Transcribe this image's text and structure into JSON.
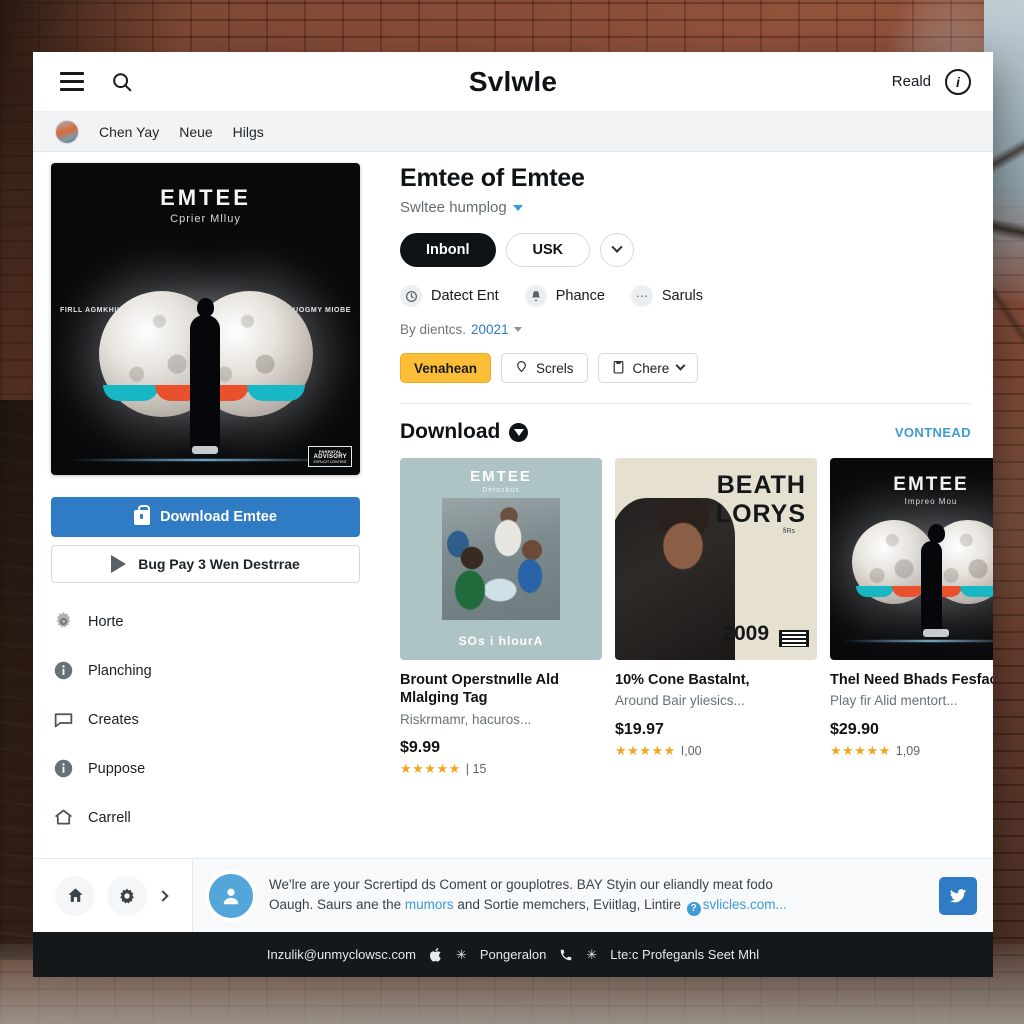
{
  "header": {
    "menu_icon": "hamburger-menu-icon",
    "search_icon": "search-icon",
    "brand": "Svlwle",
    "right_label": "Reald",
    "right_icon": "info-circle-icon"
  },
  "subnav": {
    "avatar": "user-avatar",
    "items": [
      {
        "label": "Chen Yay"
      },
      {
        "label": "Neue"
      },
      {
        "label": "Hilgs"
      }
    ]
  },
  "album": {
    "title": "EMTEE",
    "subtitle": "Cprier Mlluy",
    "side_left": "FIRLL AGMKHIKZHY",
    "side_right": "OLUOGMY MIOBE",
    "advisory_top": "PARENTAL",
    "advisory_mid": "ADVISORY",
    "advisory_bottom": "EXPLICIT CONTENT"
  },
  "sidebar": {
    "download_button": "Download Emtee",
    "download_icon": "lock-icon",
    "play_button": "Bug Pay 3 Wen Destrrae",
    "play_icon": "play-icon",
    "items": [
      {
        "label": "Horte",
        "icon": "gear-icon"
      },
      {
        "label": "Planching",
        "icon": "info-circle-icon"
      },
      {
        "label": "Creates",
        "icon": "chat-bubble-icon"
      },
      {
        "label": "Puppose",
        "icon": "info-circle-icon"
      },
      {
        "label": "Carrell",
        "icon": "home-icon"
      }
    ]
  },
  "main": {
    "title": "Emtee of Emtee",
    "subtitle": "Swltee humplog",
    "subtitle_caret": "chevron-down-icon",
    "pills": [
      {
        "label": "Inbonl",
        "style": "dark"
      },
      {
        "label": "USK",
        "style": "light"
      }
    ],
    "pill_more_icon": "chevron-down-icon",
    "meta": [
      {
        "label": "Datect Ent",
        "icon": "clock-icon"
      },
      {
        "label": "Phance",
        "icon": "bell-icon"
      },
      {
        "label": "Saruls",
        "icon": "dots-icon"
      }
    ],
    "byline_prefix": "By dientcs.",
    "byline_number": "20021",
    "byline_caret": "caret-down-icon",
    "actions": [
      {
        "label": "Venahean",
        "style": "amber",
        "icon": ""
      },
      {
        "label": "Screls",
        "style": "white",
        "icon": "location-pin-icon"
      },
      {
        "label": "Chere",
        "style": "white",
        "icon": "clipboard-icon",
        "caret": "chevron-down-icon"
      }
    ]
  },
  "download_section": {
    "title": "Download",
    "title_icon": "download-arrow-icon",
    "link": "VONTNEAD",
    "cards": [
      {
        "title": "Brount Operstnиlle Ald Mlalging Tag",
        "desc": "Riskrmamr, hacuros...",
        "price": "$9.99",
        "stars": "★★★★★",
        "rating_count": "| 15",
        "thumb_title": "EMTEE",
        "thumb_subtitle": "Detozbus",
        "thumb_bottom": "SOs i hlourA"
      },
      {
        "title": "10% Cone Bastalnt,",
        "desc": "Around Bair yliesics...",
        "price": "$19.97",
        "stars": "★★★★★",
        "rating_count": "I,00",
        "thumb_line1": "BEATH",
        "thumb_line2": "LORYS",
        "thumb_line3": "fiRs",
        "thumb_year": "2009"
      },
      {
        "title": "Thel Need Bhads Fesfacle",
        "desc": "Play fir Alid mentort...",
        "price": "$29.90",
        "stars": "★★★★★",
        "rating_count": "1,09",
        "thumb_title": "EMTEE",
        "thumb_subtitle": "Impreo Mou"
      }
    ]
  },
  "bottombar": {
    "home_icon": "home-icon",
    "settings_icon": "gear-icon",
    "expand_icon": "chevron-right-icon",
    "avatar_icon": "person-icon",
    "text_line1": "We'lre are your Scrertipd ds Coment or gouplotres. BAY Styin our eliandly meat fodo",
    "text_line2_a": "Oaugh. Saurs ane the ",
    "text_line2_link": "mumors",
    "text_line2_b": " and Sortie memchers, Eviitlag, Lintire ",
    "help_icon": "question-circle-icon",
    "text_line2_url": "svlicles.com...",
    "action_icon": "twitter-bird-icon"
  },
  "footer": {
    "email": "Inzulik@unmyclowsc.com",
    "apple_icon": "apple-icon",
    "star_icon_1": "asterisk-icon",
    "label_1": "Pongeralon",
    "phone_icon": "phone-icon",
    "star_icon_2": "asterisk-icon",
    "label_2": "Lte:c Profeganls Seet Mhl"
  },
  "colors": {
    "accent_blue": "#2f7cc4",
    "link_blue": "#3e9bd4",
    "amber": "#fbbe36",
    "star": "#f2a61f",
    "dark": "#0e1215"
  }
}
